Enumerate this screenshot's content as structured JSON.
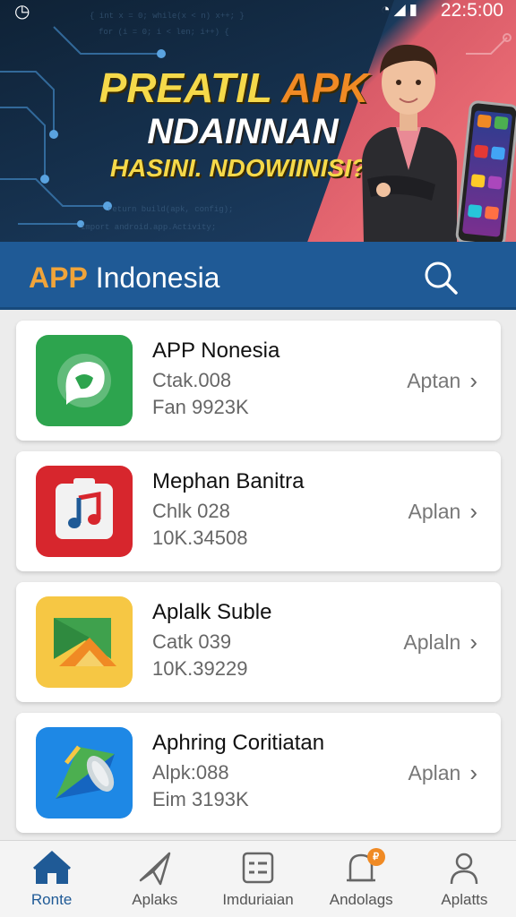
{
  "status_bar": {
    "time": "22:5:00",
    "icons": [
      "clock-icon",
      "wifi-icon",
      "signal-icon",
      "battery-icon"
    ]
  },
  "banner": {
    "line1_a": "PREATIL ",
    "line1_b": "APK",
    "line2": "NDAINNAN",
    "line3": "HASINI. NDOWIINISI?"
  },
  "header": {
    "brand": "APP",
    "title": "Indonesia",
    "search_icon": "search-icon"
  },
  "apps": [
    {
      "name": "APP Nonesia",
      "sub1": "Ctak.008",
      "sub2": "Fan 9923K",
      "action": "Aptan"
    },
    {
      "name": "Mephan Banitra",
      "sub1": "Chlk 028",
      "sub2": "10K.34508",
      "action": "Aplan"
    },
    {
      "name": "Aplalk Suble",
      "sub1": "Catk 039",
      "sub2": "10K.39229",
      "action": "Aplaln"
    },
    {
      "name": "Aphring Coritiatan",
      "sub1": "Alpk:088",
      "sub2": "Eim 3193K",
      "action": "Aplan"
    }
  ],
  "nav": [
    {
      "label": "Ronte",
      "icon": "home-icon"
    },
    {
      "label": "Aplaks",
      "icon": "send-icon"
    },
    {
      "label": "Imduriaian",
      "icon": "list-icon"
    },
    {
      "label": "Andolags",
      "icon": "bell-icon",
      "badge": "₽"
    },
    {
      "label": "Aplatts",
      "icon": "profile-icon"
    }
  ],
  "colors": {
    "header": "#1f5a96",
    "accent": "#f08a24",
    "active_nav": "#1f5a96"
  }
}
